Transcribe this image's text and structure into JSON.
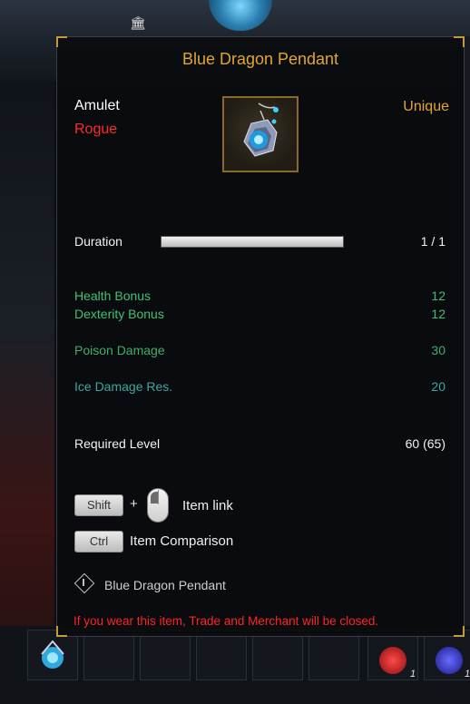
{
  "tooltip": {
    "title": "Blue Dragon Pendant",
    "item_type": "Amulet",
    "item_class": "Rogue",
    "rarity": "Unique",
    "icon": "blue-dragon-pendant-icon",
    "duration": {
      "label": "Duration",
      "value_text": "1 / 1",
      "fraction": 1.0
    },
    "stats": [
      {
        "label": "Health Bonus",
        "value": "12"
      },
      {
        "label": "Dexterity Bonus",
        "value": "12"
      },
      {
        "label": "Poison Damage",
        "value": "30"
      },
      {
        "label": "Ice Damage Res.",
        "value": "20"
      }
    ],
    "required_level": {
      "label": "Required Level",
      "value": "60 (65)"
    },
    "controls": {
      "shift_key": "Shift",
      "plus": "+",
      "item_link_label": "Item link",
      "ctrl_key": "Ctrl",
      "item_comparison_label": "Item Comparison"
    },
    "link_item_name": "Blue Dragon Pendant",
    "warning": "If you wear this item, Trade and Merchant  will be closed."
  },
  "colors": {
    "title_gold": "#e3a52a",
    "class_red": "#ff2b2b",
    "stat_green": "#3fc275",
    "stat_teal": "#3aa8a0",
    "warning_red": "#ff2424"
  },
  "hud": {
    "potion_count_1": "1",
    "potion_count_2": "1"
  }
}
